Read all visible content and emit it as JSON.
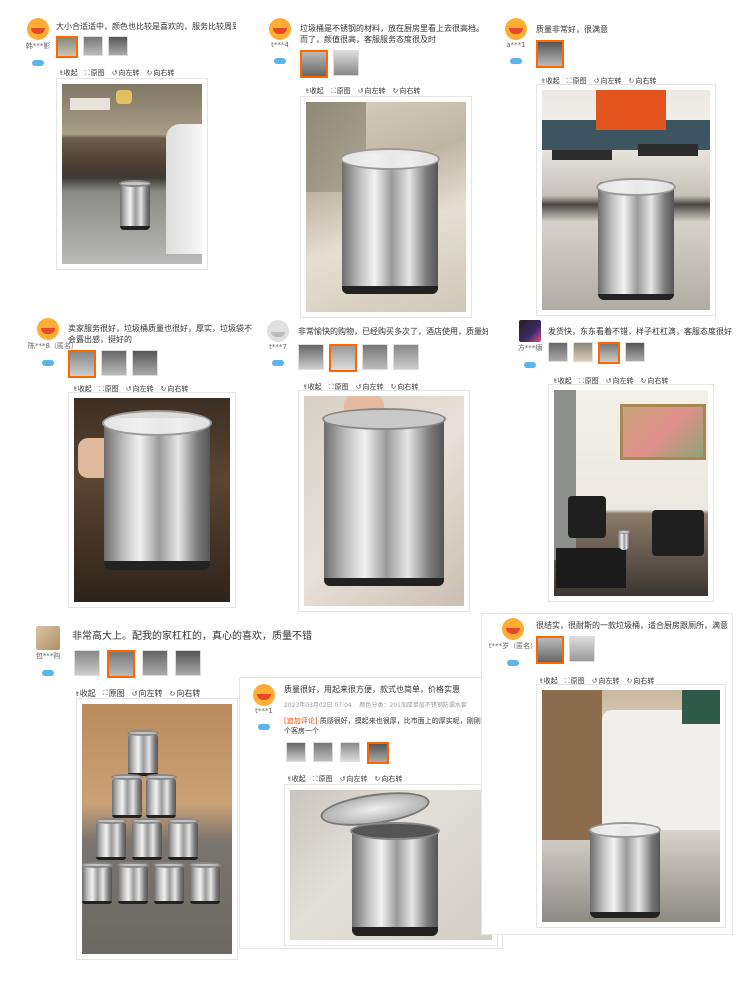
{
  "toolbar": {
    "collapse": "收起",
    "original": "原图",
    "rotate_left": "向左转",
    "rotate_right": "向右转"
  },
  "reviews": [
    {
      "user": "韩***影",
      "text": "大小合适适中，颜色也比较是喜欢的，服务比较周到，最美"
    },
    {
      "user": "t***4",
      "text": "垃圾桶是不锈钢的材料，放在厨房里看上去很高档。而了，颜值很高，客服服务态度很及时"
    },
    {
      "user": "a***1",
      "text": "质量非常好，很满意"
    },
    {
      "user": "陈***8（匿名）",
      "text": "卖家服务很好，垃圾桶质量也很好，厚实，垃圾袋不会露出感，挺好的"
    },
    {
      "user": "t***7",
      "text": "非常愉快的购物，已经购买多次了，酒店使用，质量好，产"
    },
    {
      "user": "方***缅",
      "text": "发货快，东东看着不错，样子杠杠滴，客服态度很好，"
    },
    {
      "user": "包***购",
      "text": "非常高大上。配我的家杠杠的，真心的喜欢，质量不错"
    },
    {
      "user": "t***1",
      "text": "质量很好，用起来很方便，款式也简单，价格实惠",
      "date": "2023年03月02日 07:04",
      "variant": "颜色分类：201加厚单层不锈钢防漏水套",
      "append_tag": "[追加评论]",
      "append_text": "质感很好，摸起来也很厚，比市面上的厚实呢，刚刚好摆个客房一个"
    },
    {
      "user": "t***岁（匿名）",
      "text": "很结实，很耐斯的一款垃圾桶，适合厨房跟厕所，满意"
    }
  ]
}
